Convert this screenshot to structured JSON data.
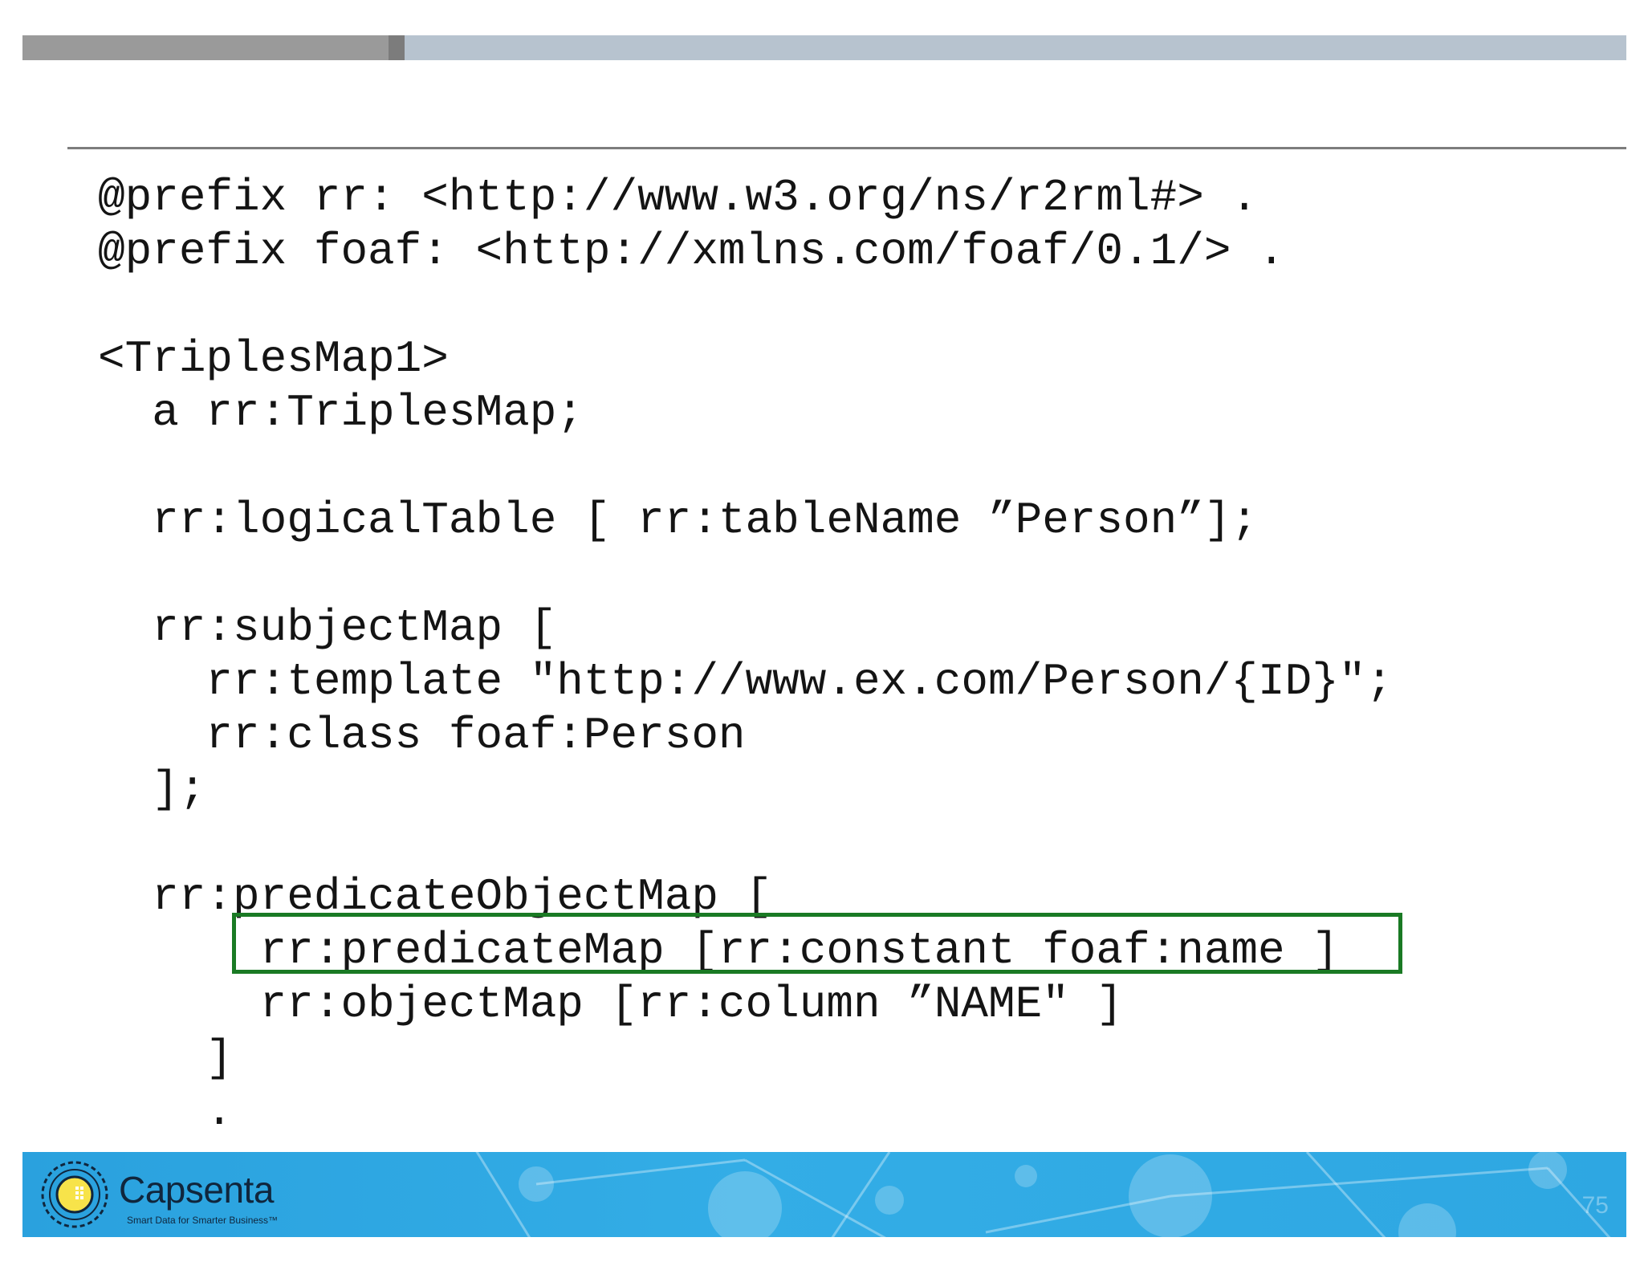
{
  "code_lines": [
    "@prefix rr: <http://www.w3.org/ns/r2rml#> .",
    "@prefix foaf: <http://xmlns.com/foaf/0.1/> .",
    "",
    "<TriplesMap1>",
    "  a rr:TriplesMap;",
    "",
    "  rr:logicalTable [ rr:tableName ”Person”];",
    "",
    "  rr:subjectMap [",
    "    rr:template \"http://www.ex.com/Person/{ID}\";",
    "    rr:class foaf:Person",
    "  ];",
    "",
    "  rr:predicateObjectMap [",
    "      rr:predicateMap [rr:constant foaf:name ]",
    "      rr:objectMap [rr:column ”NAME\" ]",
    "    ]",
    "    ."
  ],
  "highlight": {
    "line_index": 14,
    "color": "#1a7a24"
  },
  "footer": {
    "brand_name": "Capsenta",
    "tagline": "Smart Data for Smarter Business™",
    "slide_number": "75",
    "background_color": "#2ea7e2",
    "logo_icon": "capsenta-logo-icon"
  },
  "colors": {
    "top_bar_dark": "#9a9a9a",
    "top_bar_light": "#b7c3cf",
    "rule": "#7d7d7d",
    "text": "#141414"
  }
}
